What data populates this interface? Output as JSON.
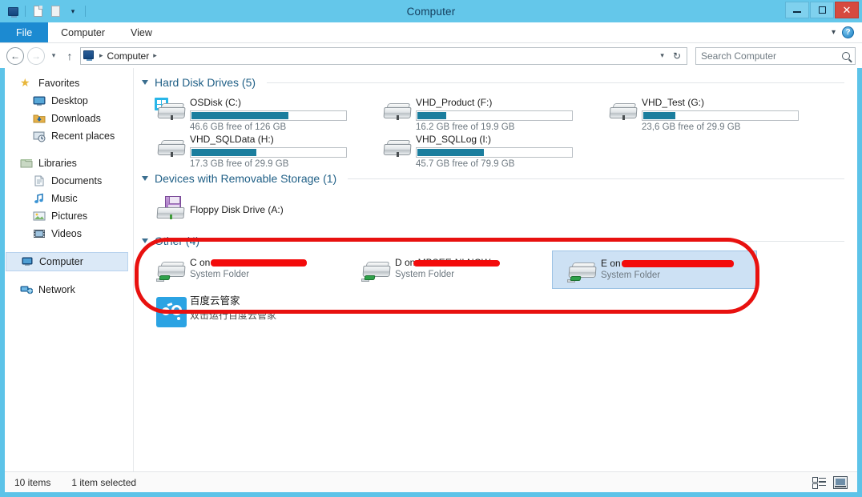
{
  "window": {
    "title": "Computer",
    "quick_access": [
      "computer-icon",
      "new-folder-icon",
      "properties-icon",
      "customize-caret"
    ],
    "buttons": {
      "minimize": "–",
      "maximize": "□",
      "close": "✕"
    }
  },
  "ribbon": {
    "tabs": [
      {
        "label": "File",
        "active": true
      },
      {
        "label": "Computer",
        "active": false
      },
      {
        "label": "View",
        "active": false
      }
    ],
    "collapse_caret": "⌄",
    "help_label": "?"
  },
  "addressbar": {
    "back": "←",
    "forward": "→",
    "recent_caret": "▾",
    "up": "↑",
    "crumbs": [
      "Computer"
    ],
    "separator": "▸",
    "dropdown_caret": "⌄",
    "refresh": "↻",
    "search_placeholder": "Search Computer"
  },
  "sidebar": {
    "groups": [
      {
        "label": "Favorites",
        "icon": "star-icon",
        "children": [
          {
            "label": "Desktop",
            "icon": "desktop-icon"
          },
          {
            "label": "Downloads",
            "icon": "downloads-icon"
          },
          {
            "label": "Recent places",
            "icon": "recent-places-icon"
          }
        ]
      },
      {
        "label": "Libraries",
        "icon": "libraries-icon",
        "children": [
          {
            "label": "Documents",
            "icon": "documents-icon"
          },
          {
            "label": "Music",
            "icon": "music-icon"
          },
          {
            "label": "Pictures",
            "icon": "pictures-icon"
          },
          {
            "label": "Videos",
            "icon": "videos-icon"
          }
        ]
      },
      {
        "label": "Computer",
        "icon": "computer-icon",
        "selected": true,
        "children": []
      },
      {
        "label": "Network",
        "icon": "network-icon",
        "children": []
      }
    ]
  },
  "main": {
    "sections": [
      {
        "title": "Hard Disk Drives (5)",
        "items": [
          {
            "name": "OSDisk (C:)",
            "sub": "46.6 GB free of 126 GB",
            "used_pct": 63,
            "icon": "windows-drive-icon"
          },
          {
            "name": "VHD_Product (F:)",
            "sub": "16.2 GB free of 19.9 GB",
            "used_pct": 19,
            "icon": "drive-icon"
          },
          {
            "name": "VHD_Test (G:)",
            "sub": "23,6 GB free of 29.9 GB",
            "used_pct": 21,
            "icon": "drive-icon"
          },
          {
            "name": "VHD_SQLData (H:)",
            "sub": "17.3 GB free of 29.9 GB",
            "used_pct": 42,
            "icon": "drive-icon"
          },
          {
            "name": "VHD_SQLLog (I:)",
            "sub": "45.7 GB free of 79.9 GB",
            "used_pct": 43,
            "icon": "drive-icon"
          }
        ]
      },
      {
        "title": "Devices with Removable Storage (1)",
        "items": [
          {
            "name": "Floppy Disk Drive (A:)",
            "sub": "",
            "icon": "floppy-icon"
          }
        ]
      },
      {
        "title": "Other (4)",
        "items": [
          {
            "name_prefix": "C on",
            "redacted": true,
            "redact_width": 120,
            "sub": "System Folder",
            "icon": "network-drive-icon",
            "selected": false
          },
          {
            "name_prefix": "D on MBSEE-NLNOW",
            "redacted": true,
            "redact_width": 108,
            "sub": "System Folder",
            "icon": "network-drive-icon",
            "selected": false
          },
          {
            "name_prefix": "E on",
            "redacted": true,
            "redact_width": 140,
            "sub": "System Folder",
            "icon": "network-drive-icon",
            "selected": true
          },
          {
            "name_prefix": "百度云管家",
            "redacted": false,
            "sub": "双击运行百度云管家",
            "icon": "baidu-cloud-icon",
            "selected": false
          }
        ]
      }
    ]
  },
  "statusbar": {
    "item_count": "10 items",
    "selection": "1 item selected",
    "view_details_icon": "details-view-icon",
    "view_tiles_icon": "large-icons-view-icon"
  },
  "annotation": {
    "color": "#e8110f",
    "shape": "oval-highlight",
    "redaction_color": "#f30b0b"
  }
}
